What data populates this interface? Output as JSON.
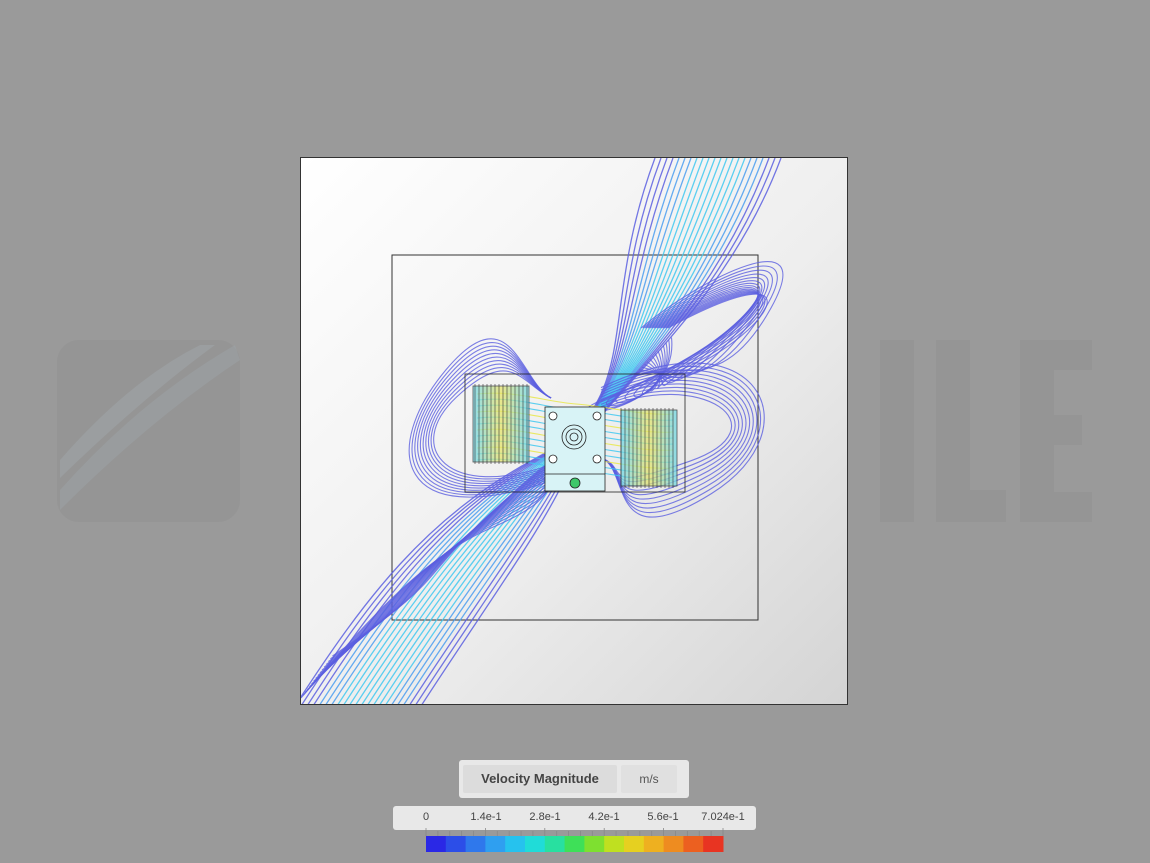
{
  "legend": {
    "quantity": "Velocity Magnitude",
    "unit": "m/s",
    "ticks": [
      "0",
      "1.4e-1",
      "2.8e-1",
      "4.2e-1",
      "5.6e-1",
      "7.024e-1"
    ],
    "range": [
      0,
      0.7024
    ]
  },
  "colors": {
    "background": "#9a9a9a",
    "streamline_low": "#5b5fe0",
    "streamline_mid": "#41c8f0",
    "streamline_high": "#e8e84a",
    "colormap": [
      "#2a28e6",
      "#2c4ee8",
      "#2f78ec",
      "#2f9ff0",
      "#26c2ee",
      "#20dcd8",
      "#28e0a0",
      "#3ee058",
      "#7ee030",
      "#bfe020",
      "#e6d020",
      "#eeb020",
      "#ee8c20",
      "#ec6020",
      "#e83422"
    ]
  }
}
